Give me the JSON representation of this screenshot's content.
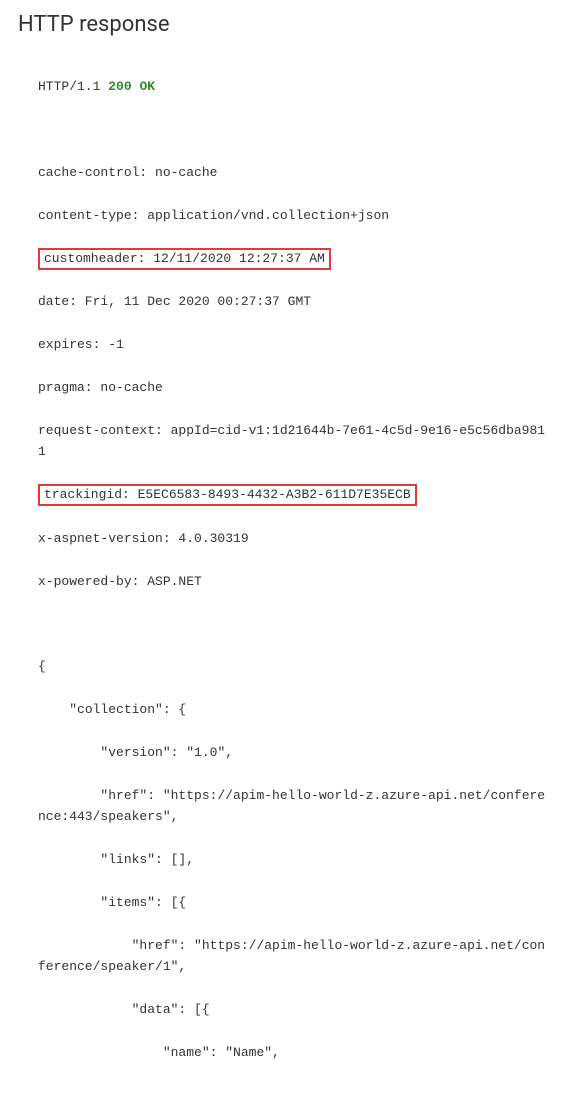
{
  "title": "HTTP response",
  "protocol": "HTTP/1.1",
  "status": "200 OK",
  "headers": {
    "cache_control": "cache-control: no-cache",
    "content_type": "content-type: application/vnd.collection+json",
    "customheader": "customheader: 12/11/2020 12:27:37 AM",
    "date": "date: Fri, 11 Dec 2020 00:27:37 GMT",
    "expires": "expires: -1",
    "pragma": "pragma: no-cache",
    "request_context": "request-context: appId=cid-v1:1d21644b-7e61-4c5d-9e16-e5c56dba9811",
    "trackingid": "trackingid: E5EC6583-8493-4432-A3B2-611D7E35ECB",
    "x_aspnet_version": "x-aspnet-version: 4.0.30319",
    "x_powered_by": "x-powered-by: ASP.NET"
  },
  "body_lines": {
    "l1": "{",
    "l2": "    \"collection\": {",
    "l3": "        \"version\": \"1.0\",",
    "l4": "        \"href\": \"https://apim-hello-world-z.azure-api.net/conference:443/speakers\",",
    "l5": "        \"links\": [],",
    "l6": "        \"items\": [{",
    "l7": "            \"href\": \"https://apim-hello-world-z.azure-api.net/conference/speaker/1\",",
    "l8": "            \"data\": [{",
    "l9": "                \"name\": \"Name\","
  }
}
